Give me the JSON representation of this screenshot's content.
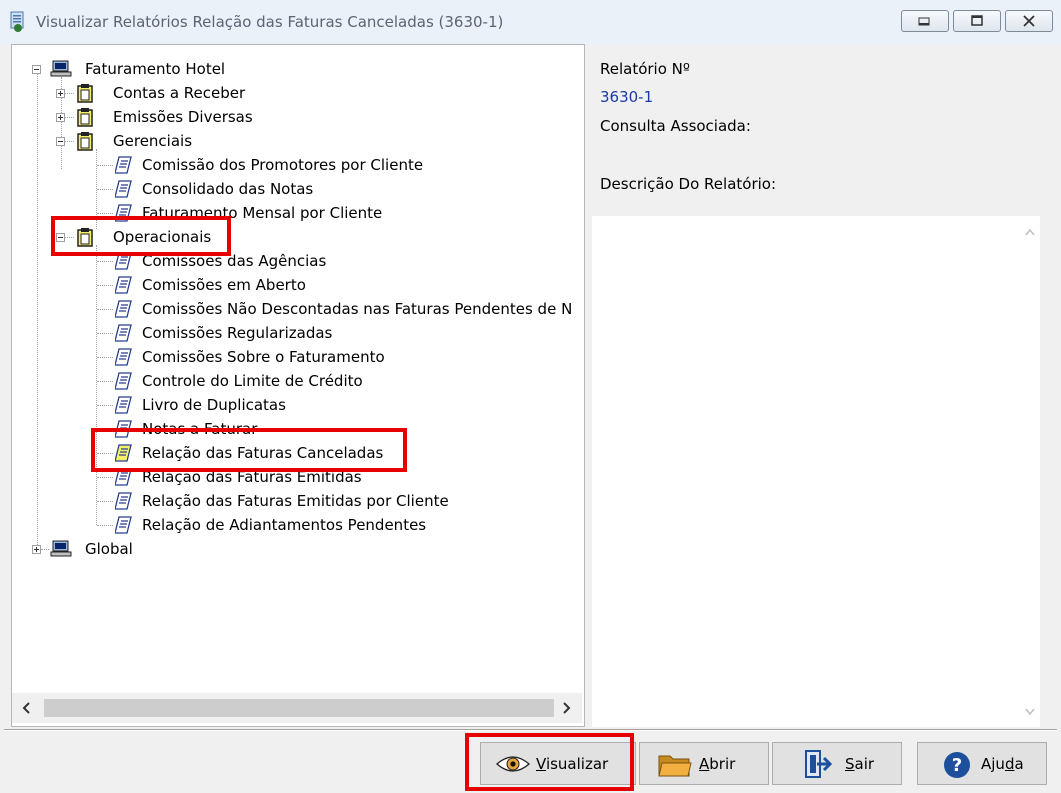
{
  "window": {
    "title": "Visualizar Relatórios Relação das Faturas Canceladas (3630-1)",
    "minimize_label": "minimize",
    "maximize_label": "maximize",
    "close_label": "close"
  },
  "tree": {
    "root": "Faturamento Hotel",
    "contas_a_receber": "Contas a Receber",
    "emissoes_diversas": "Emissões Diversas",
    "gerenciais": "Gerenciais",
    "gerenciais_items": [
      "Comissão dos Promotores por Cliente",
      "Consolidado das Notas",
      "Faturamento Mensal por Cliente"
    ],
    "operacionais": "Operacionais",
    "operacionais_items": [
      "Comissões das Agências",
      "Comissões em Aberto",
      "Comissões Não Descontadas nas Faturas Pendentes de N",
      "Comissões Regularizadas",
      "Comissões Sobre o Faturamento",
      "Controle do Limite de Crédito",
      "Livro de Duplicatas",
      "Notas a Faturar",
      "Relação das Faturas Canceladas",
      "Relação das Faturas Emitidas",
      "Relação das Faturas Emitidas por Cliente",
      "Relação de Adiantamentos Pendentes"
    ],
    "global": "Global"
  },
  "details": {
    "report_number_label": "Relatório Nº",
    "report_number_value": "3630-1",
    "associated_query_label": "Consulta Associada:",
    "description_label": "Descrição Do Relatório:"
  },
  "buttons": {
    "visualizar_pre": "",
    "visualizar_key": "V",
    "visualizar_post": "isualizar",
    "abrir_key": "A",
    "abrir_post": "brir",
    "sair_key": "S",
    "sair_post": "air",
    "ajuda_pre": "Aju",
    "ajuda_key": "d",
    "ajuda_post": "a"
  },
  "colors": {
    "highlight": "#e60000",
    "report_number": "#1a3aa8"
  }
}
